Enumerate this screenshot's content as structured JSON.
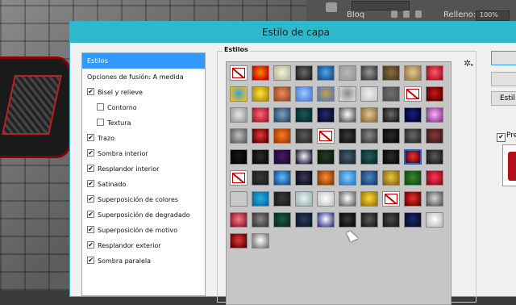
{
  "dialog": {
    "title": "Estilo de capa"
  },
  "sidebar": {
    "items": [
      {
        "label": "Estilos",
        "checkbox": false,
        "checked": false,
        "indent": 0,
        "selected": true
      },
      {
        "label": "Opciones de fusión: A medida",
        "checkbox": false,
        "checked": false,
        "indent": 0,
        "selected": false
      },
      {
        "label": "Bisel y relieve",
        "checkbox": true,
        "checked": true,
        "indent": 0,
        "selected": false
      },
      {
        "label": "Contorno",
        "checkbox": true,
        "checked": false,
        "indent": 1,
        "selected": false
      },
      {
        "label": "Textura",
        "checkbox": true,
        "checked": false,
        "indent": 1,
        "selected": false
      },
      {
        "label": "Trazo",
        "checkbox": true,
        "checked": true,
        "indent": 0,
        "selected": false
      },
      {
        "label": "Sombra interior",
        "checkbox": true,
        "checked": true,
        "indent": 0,
        "selected": false
      },
      {
        "label": "Resplandor interior",
        "checkbox": true,
        "checked": true,
        "indent": 0,
        "selected": false
      },
      {
        "label": "Satinado",
        "checkbox": true,
        "checked": true,
        "indent": 0,
        "selected": false
      },
      {
        "label": "Superposición de colores",
        "checkbox": true,
        "checked": true,
        "indent": 0,
        "selected": false
      },
      {
        "label": "Superposición de degradado",
        "checkbox": true,
        "checked": true,
        "indent": 0,
        "selected": false
      },
      {
        "label": "Superposición de motivo",
        "checkbox": true,
        "checked": true,
        "indent": 0,
        "selected": false
      },
      {
        "label": "Resplandor exterior",
        "checkbox": true,
        "checked": true,
        "indent": 0,
        "selected": false
      },
      {
        "label": "Sombra paralela",
        "checkbox": true,
        "checked": true,
        "indent": 0,
        "selected": false
      }
    ]
  },
  "styles": {
    "label": "Estilos",
    "settings_icon": "gear-icon",
    "selected_index": 48,
    "swatches": [
      {
        "c1": "#ffffff",
        "c2": "#ffffff",
        "none": true
      },
      {
        "c1": "#ff8c00",
        "c2": "#c00000"
      },
      {
        "c1": "#f4f4d8",
        "c2": "#b8b8a0"
      },
      {
        "c1": "#6a6a6a",
        "c2": "#202020"
      },
      {
        "c1": "#4aa8e8",
        "c2": "#1a4a8a"
      },
      {
        "c1": "#b8b8b8",
        "c2": "#9a9a9a"
      },
      {
        "c1": "#9a9a9a",
        "c2": "#3a3a3a"
      },
      {
        "c1": "#8a7040",
        "c2": "#4a3a20"
      },
      {
        "c1": "#e8c890",
        "c2": "#9a7a4a"
      },
      {
        "c1": "#ff5a6a",
        "c2": "#a01020"
      },
      {
        "c1": "#40a0d8",
        "c2": "#e8c020"
      },
      {
        "c1": "#ffe840",
        "c2": "#b08a00"
      },
      {
        "c1": "#e89060",
        "c2": "#9a4a20"
      },
      {
        "c1": "#a0c8ff",
        "c2": "#4a80d8"
      },
      {
        "c1": "#c8a050",
        "c2": "#5a7ab0"
      },
      {
        "c1": "#8a8a8a",
        "c2": "#d8d8d8"
      },
      {
        "c1": "#f0f0f0",
        "c2": "#c8c8c8"
      },
      {
        "c1": "#707070",
        "c2": "#505050"
      },
      {
        "c1": "#ffffff",
        "c2": "#ffffff",
        "none": true
      },
      {
        "c1": "#d01818",
        "c2": "#500000"
      },
      {
        "c1": "#e8e8e8",
        "c2": "#9a9a9a"
      },
      {
        "c1": "#ff6a7a",
        "c2": "#a01828"
      },
      {
        "c1": "#80a0c0",
        "c2": "#2a4a6a"
      },
      {
        "c1": "#1a5a5a",
        "c2": "#0a2a2a"
      },
      {
        "c1": "#2a2a6a",
        "c2": "#0a0a2a"
      },
      {
        "c1": "#ffffff",
        "c2": "#5a5a5a"
      },
      {
        "c1": "#e8c890",
        "c2": "#8a7040"
      },
      {
        "c1": "#6a6a6a",
        "c2": "#1a1a1a"
      },
      {
        "c1": "#202080",
        "c2": "#000030"
      },
      {
        "c1": "#ffb0ff",
        "c2": "#8a3a8a"
      },
      {
        "c1": "#c0c0c0",
        "c2": "#606060"
      },
      {
        "c1": "#e83a3a",
        "c2": "#5a0000"
      },
      {
        "c1": "#ff7a20",
        "c2": "#a03a00"
      },
      {
        "c1": "#5a5a5a",
        "c2": "#2a2a2a"
      },
      {
        "c1": "#ffffff",
        "c2": "#ffffff",
        "none": true
      },
      {
        "c1": "#3a3a3a",
        "c2": "#101010"
      },
      {
        "c1": "#8a8a8a",
        "c2": "#3a3a3a"
      },
      {
        "c1": "#2a2a2a",
        "c2": "#0a0a0a"
      },
      {
        "c1": "#6a6a6a",
        "c2": "#2a2a2a"
      },
      {
        "c1": "#8a3a3a",
        "c2": "#3a1a1a"
      },
      {
        "c1": "#1a1a1a",
        "c2": "#000000"
      },
      {
        "c1": "#2a2a2a",
        "c2": "#0a0a0a"
      },
      {
        "c1": "#4a1a6a",
        "c2": "#1a0a2a"
      },
      {
        "c1": "#f0f0f0",
        "c2": "#1a1a3a"
      },
      {
        "c1": "#2a3a2a",
        "c2": "#0a1a0a"
      },
      {
        "c1": "#4a5a6a",
        "c2": "#1a2a3a"
      },
      {
        "c1": "#2a5a5a",
        "c2": "#0a2a2a"
      },
      {
        "c1": "#2a2a2a",
        "c2": "#0a0a0a"
      },
      {
        "c1": "#e83a3a",
        "c2": "#5a0000"
      },
      {
        "c1": "#5a5a5a",
        "c2": "#1a1a1a"
      },
      {
        "c1": "#ffffff",
        "c2": "#ffffff",
        "none": true
      },
      {
        "c1": "#3a3a3a",
        "c2": "#1a1a1a"
      },
      {
        "c1": "#60c0ff",
        "c2": "#1a4a8a"
      },
      {
        "c1": "#3a3a5a",
        "c2": "#0a0a1a"
      },
      {
        "c1": "#ff8a3a",
        "c2": "#8a3a00"
      },
      {
        "c1": "#80d0ff",
        "c2": "#2a7ac8"
      },
      {
        "c1": "#4a8ac8",
        "c2": "#1a3a6a"
      },
      {
        "c1": "#e8c840",
        "c2": "#8a6a10"
      },
      {
        "c1": "#3a8a3a",
        "c2": "#0a4a0a"
      },
      {
        "c1": "#ff3a5a",
        "c2": "#8a0a1a"
      },
      {
        "c1": "#c8c8c8",
        "c2": "#c8c8c8"
      },
      {
        "c1": "#20b0e8",
        "c2": "#0a6aa0"
      },
      {
        "c1": "#3a3a3a",
        "c2": "#1a1a1a"
      },
      {
        "c1": "#e8f0f0",
        "c2": "#a0b8b8"
      },
      {
        "c1": "#ffffff",
        "c2": "#c8c8c8"
      },
      {
        "c1": "#ffffff",
        "c2": "#6a6a6a"
      },
      {
        "c1": "#ffd840",
        "c2": "#a07a00"
      },
      {
        "c1": "#ffffff",
        "c2": "#ffffff",
        "none": true
      },
      {
        "c1": "#e83030",
        "c2": "#6a0000"
      },
      {
        "c1": "#d8d8d8",
        "c2": "#5a5a5a"
      },
      {
        "c1": "#ff7a8a",
        "c2": "#8a1a2a"
      },
      {
        "c1": "#8a8a8a",
        "c2": "#3a3a3a"
      },
      {
        "c1": "#1a5a4a",
        "c2": "#0a2a20"
      },
      {
        "c1": "#2a3a5a",
        "c2": "#0a1a2a"
      },
      {
        "c1": "#ffffff",
        "c2": "#3a3a8a"
      },
      {
        "c1": "#3a3a3a",
        "c2": "#0a0a0a"
      },
      {
        "c1": "#5a5a5a",
        "c2": "#1a1a1a"
      },
      {
        "c1": "#4a4a4a",
        "c2": "#1a1a1a"
      },
      {
        "c1": "#1a2a6a",
        "c2": "#0a0a2a"
      },
      {
        "c1": "#ffffff",
        "c2": "#c0c0c0"
      },
      {
        "c1": "#e83a3a",
        "c2": "#5a0000"
      },
      {
        "c1": "#ffffff",
        "c2": "#7a7a7a"
      }
    ]
  },
  "right_controls": {
    "buttons": [
      "Estil"
    ],
    "preview_label": "Pre",
    "preview_checked": true
  },
  "topbar": {
    "label_blend": "Bloq",
    "label_fill": "Relleno:",
    "fill_value": "100%"
  }
}
